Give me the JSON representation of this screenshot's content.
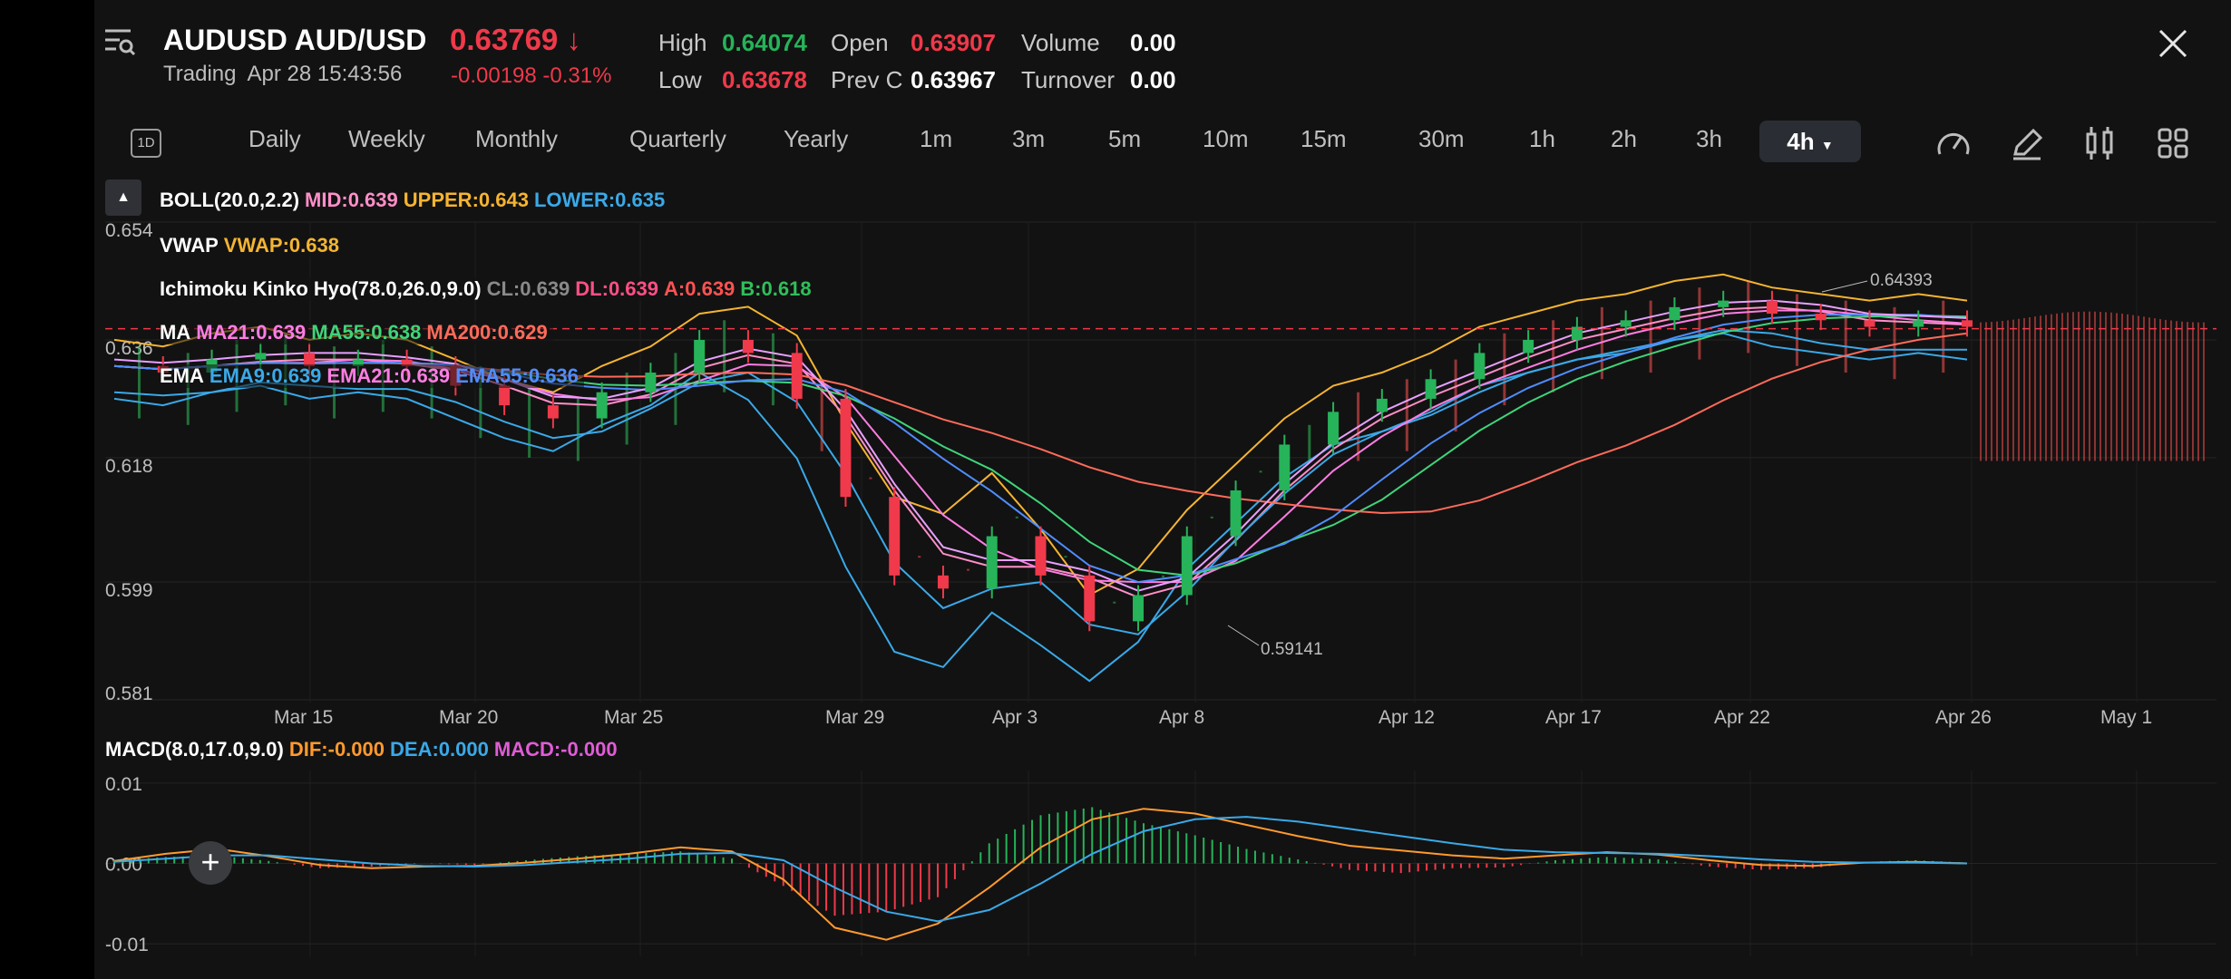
{
  "header": {
    "symbol": "AUDUSD",
    "pair": "AUD/USD",
    "price": "0.63769",
    "arrow": "↓",
    "status": "Trading",
    "datetime": "Apr 28 15:43:56",
    "change": "-0.00198",
    "change_pct": "-0.31%",
    "stats": {
      "high_label": "High",
      "high": "0.64074",
      "low_label": "Low",
      "low": "0.63678",
      "open_label": "Open",
      "open": "0.63907",
      "prev_label": "Prev C",
      "prev": "0.63967",
      "volume_label": "Volume",
      "volume": "0.00",
      "turnover_label": "Turnover",
      "turnover": "0.00"
    }
  },
  "timeframes": {
    "badge": "1D",
    "items": [
      "Daily",
      "Weekly",
      "Monthly",
      "Quarterly",
      "Yearly",
      "1m",
      "3m",
      "5m",
      "10m",
      "15m",
      "30m",
      "1h",
      "2h",
      "3h"
    ],
    "active": "4h"
  },
  "indicators": {
    "boll": {
      "name": "BOLL(20.0,2.2)",
      "mid": "MID:0.639",
      "upper": "UPPER:0.643",
      "lower": "LOWER:0.635"
    },
    "vwap": {
      "name": "VWAP",
      "value": "VWAP:0.638"
    },
    "ichimoku": {
      "name": "Ichimoku Kinko Hyo(78.0,26.0,9.0)",
      "cl": "CL:0.639",
      "dl": "DL:0.639",
      "a": "A:0.639",
      "b": "B:0.618"
    },
    "ma": {
      "name": "MA",
      "ma21": "MA21:0.639",
      "ma55": "MA55:0.638",
      "ma200": "MA200:0.629"
    },
    "ema": {
      "name": "EMA",
      "ema9": "EMA9:0.639",
      "ema21": "EMA21:0.639",
      "ema55": "EMA55:0.636"
    },
    "macd": {
      "name": "MACD(8.0,17.0,9.0)",
      "dif": "DIF:-0.000",
      "dea": "DEA:0.000",
      "macd": "MACD:-0.000"
    }
  },
  "colors": {
    "up": "#26b35a",
    "down": "#f0394a",
    "mid": "#ff8fc8",
    "upper": "#f5b431",
    "lower": "#3aa9e8",
    "vwap": "#f5b431",
    "cl": "#8a8a8a",
    "dl": "#ff4f86",
    "a": "#ff5252",
    "b": "#2fbf5a",
    "ma21": "#ff7de3",
    "ma55": "#3fd47a",
    "ma200": "#ff6b5a",
    "ema9": "#3aa9e8",
    "ema21": "#ff7de3",
    "ema55": "#4f8dff",
    "dif": "#ff9a2e",
    "dea": "#3aa9e8",
    "macd_hist": "#e05cd6"
  },
  "chart_data": [
    {
      "type": "line",
      "title": "AUDUSD 4h",
      "y_ticks": [
        "0.654",
        "0.636",
        "0.618",
        "0.599",
        "0.581"
      ],
      "ylim": [
        0.581,
        0.654
      ],
      "x_ticks": [
        "Mar 15",
        "Mar 20",
        "Mar 25",
        "Mar 29",
        "Apr 3",
        "Apr 8",
        "Apr 12",
        "Apr 17",
        "Apr 22",
        "Apr 26",
        "May 1"
      ],
      "annotations": [
        {
          "label": "0.64393"
        },
        {
          "label": "0.59141"
        }
      ],
      "last_price_line": 0.6377,
      "series": [
        {
          "name": "Close",
          "values": [
            0.632,
            0.631,
            0.633,
            0.634,
            0.632,
            0.633,
            0.632,
            0.629,
            0.626,
            0.624,
            0.628,
            0.631,
            0.636,
            0.634,
            0.627,
            0.612,
            0.6,
            0.598,
            0.606,
            0.6,
            0.593,
            0.597,
            0.606,
            0.613,
            0.62,
            0.625,
            0.627,
            0.63,
            0.634,
            0.636,
            0.638,
            0.639,
            0.641,
            0.642,
            0.64,
            0.639,
            0.638,
            0.639,
            0.638
          ]
        }
      ]
    },
    {
      "type": "bar",
      "title": "MACD(8.0,17.0,9.0)",
      "y_ticks": [
        "0.01",
        "0.00",
        "-0.01"
      ],
      "ylim": [
        -0.011,
        0.011
      ],
      "series": [
        {
          "name": "MACD",
          "values": [
            0.0004,
            0.0008,
            0.001,
            0.0003,
            -0.0006,
            -0.0004,
            0.0,
            -0.0002,
            0.0004,
            0.0009,
            0.0012,
            0.0015,
            0.0006,
            -0.0028,
            -0.0065,
            -0.006,
            -0.0042,
            0.0025,
            0.006,
            0.007,
            0.005,
            0.0035,
            0.0018,
            0.0005,
            -0.0008,
            -0.0012,
            -0.0006,
            -0.0005,
            0.0004,
            0.0008,
            0.0005,
            -0.0004,
            -0.0008,
            -0.0006,
            0.0002,
            0.0004,
            0.0001
          ]
        },
        {
          "name": "DIF",
          "values": [
            0.0003,
            0.0012,
            0.0018,
            0.0009,
            -0.0002,
            -0.0006,
            -0.0004,
            -0.0003,
            0.0001,
            0.0006,
            0.0012,
            0.002,
            0.0015,
            -0.002,
            -0.008,
            -0.0095,
            -0.0075,
            -0.003,
            0.002,
            0.0055,
            0.0068,
            0.0062,
            0.0048,
            0.0034,
            0.0022,
            0.0016,
            0.001,
            0.0006,
            0.001,
            0.0014,
            0.0011,
            0.0004,
            -0.0002,
            -0.0003,
            0.0001,
            0.0002,
            0.0
          ]
        },
        {
          "name": "DEA",
          "values": [
            0.0002,
            0.0006,
            0.001,
            0.001,
            0.0005,
            0.0,
            -0.0003,
            -0.0004,
            -0.0002,
            0.0002,
            0.0006,
            0.0012,
            0.0013,
            0.0004,
            -0.003,
            -0.006,
            -0.0072,
            -0.0058,
            -0.0025,
            0.0012,
            0.004,
            0.0055,
            0.0058,
            0.0052,
            0.0043,
            0.0034,
            0.0025,
            0.0017,
            0.0014,
            0.0013,
            0.0012,
            0.0009,
            0.0005,
            0.0002,
            0.0001,
            0.0001,
            0.0
          ]
        }
      ]
    }
  ]
}
